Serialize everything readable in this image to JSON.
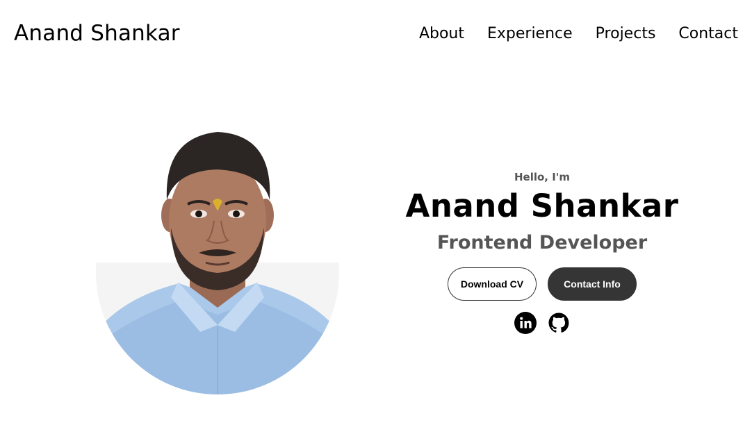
{
  "nav": {
    "logo": "Anand Shankar",
    "links": [
      {
        "label": "About"
      },
      {
        "label": "Experience"
      },
      {
        "label": "Projects"
      },
      {
        "label": "Contact"
      }
    ]
  },
  "profile": {
    "greeting": "Hello, I'm",
    "name": "Anand Shankar",
    "role": "Frontend Developer"
  },
  "buttons": {
    "download_cv": "Download CV",
    "contact_info": "Contact Info"
  },
  "socials": [
    {
      "icon": "linkedin-icon"
    },
    {
      "icon": "github-icon"
    }
  ],
  "colors": {
    "text": "#000000",
    "muted": "#555555",
    "dark_button": "#353535",
    "shirt": "#a9c8ea"
  }
}
